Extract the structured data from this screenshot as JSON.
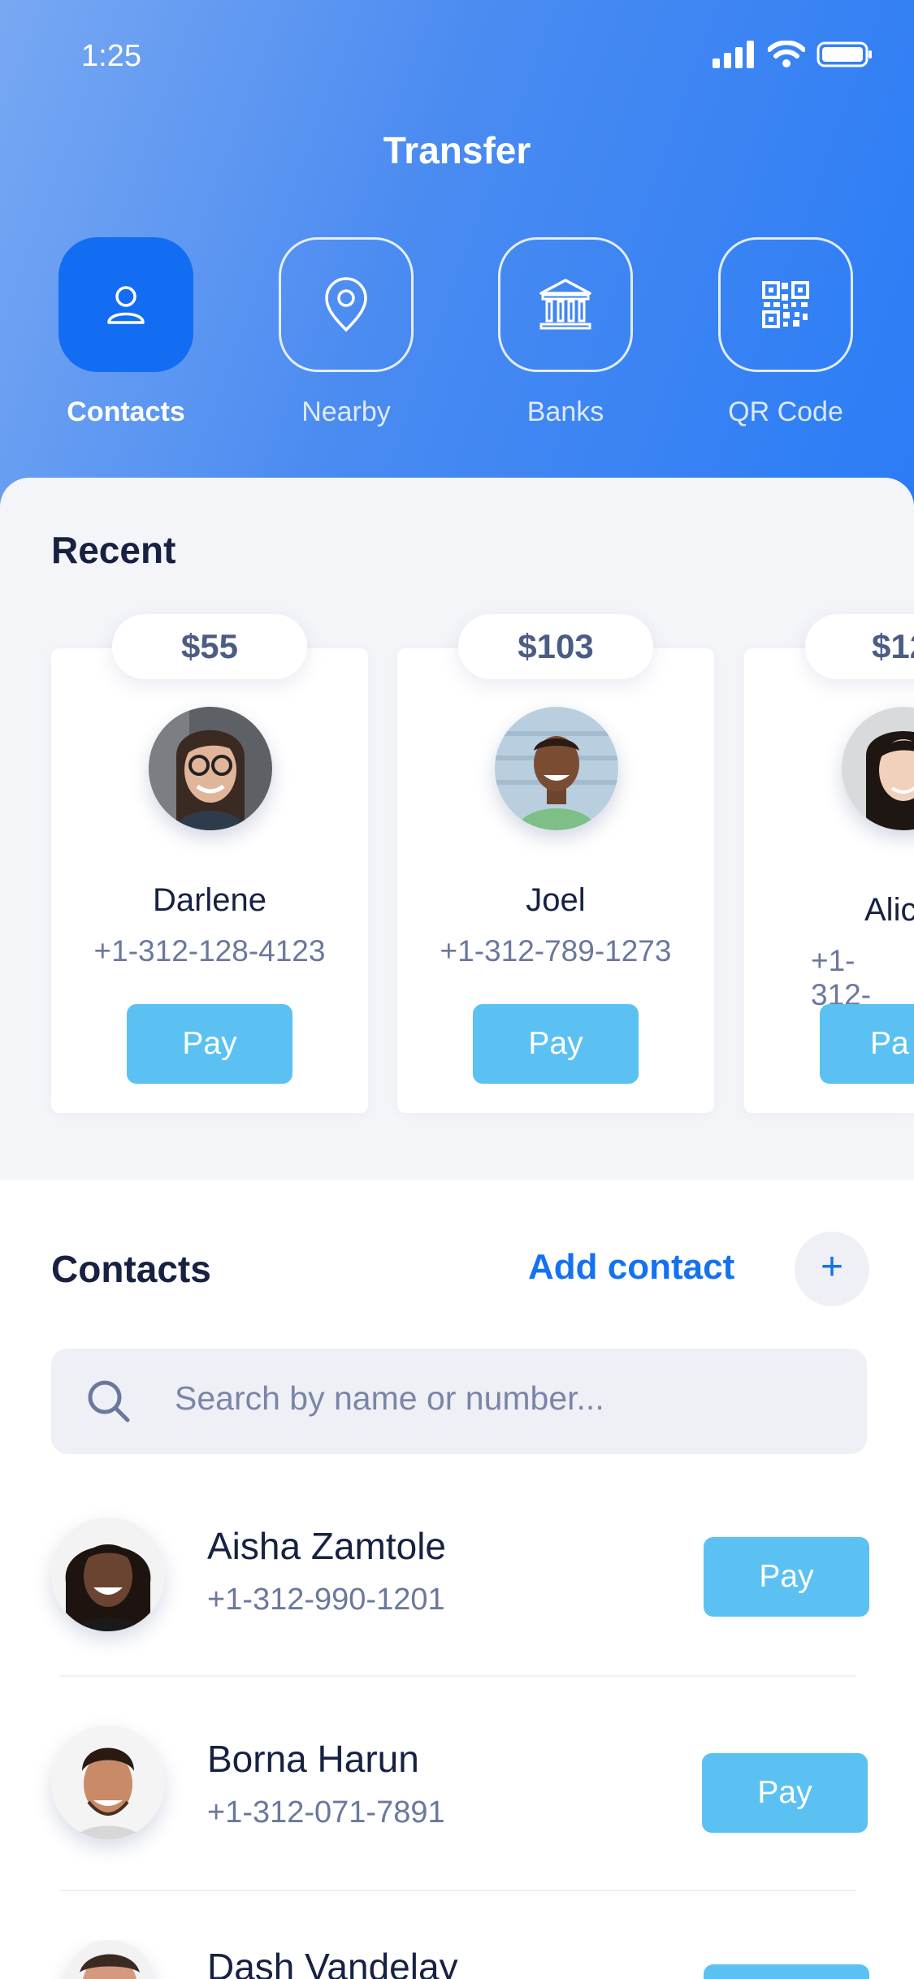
{
  "status": {
    "time": "1:25"
  },
  "header": {
    "title": "Transfer"
  },
  "tabs": [
    {
      "label": "Contacts",
      "icon": "user-icon",
      "active": true
    },
    {
      "label": "Nearby",
      "icon": "location-pin-icon",
      "active": false
    },
    {
      "label": "Banks",
      "icon": "bank-icon",
      "active": false
    },
    {
      "label": "QR Code",
      "icon": "qr-code-icon",
      "active": false
    }
  ],
  "recent": {
    "title": "Recent",
    "cards": [
      {
        "amount": "$55",
        "name": "Darlene",
        "phone": "+1-312-128-4123",
        "pay_label": "Pay"
      },
      {
        "amount": "$103",
        "name": "Joel",
        "phone": "+1-312-789-1273",
        "pay_label": "Pay"
      },
      {
        "amount": "$12",
        "name": "Alic",
        "phone": "+1-312-",
        "pay_label": "Pa"
      }
    ]
  },
  "contacts": {
    "title": "Contacts",
    "add_label": "Add contact",
    "add_icon": "+",
    "search_placeholder": "Search by name or number...",
    "items": [
      {
        "name": "Aisha Zamtole",
        "phone": "+1-312-990-1201",
        "pay_label": "Pay"
      },
      {
        "name": "Borna Harun",
        "phone": "+1-312-071-7891",
        "pay_label": "Pay"
      },
      {
        "name": "Dash Vandelay",
        "phone": "",
        "pay_label": ""
      }
    ]
  },
  "colors": {
    "accent": "#136df3",
    "pay": "#5bc1f2",
    "link": "#1472f0"
  }
}
